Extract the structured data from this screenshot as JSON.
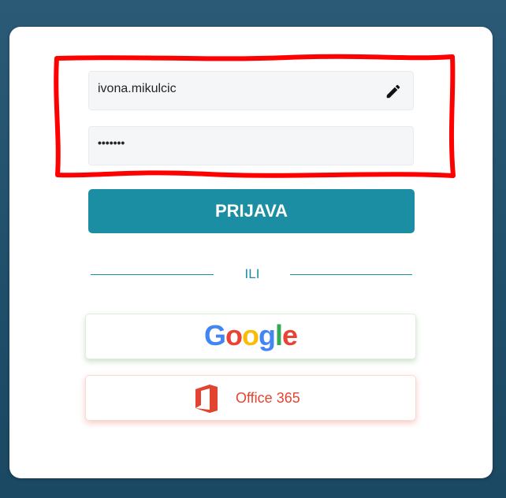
{
  "login": {
    "username_value": "ivona.mikulcic",
    "password_masked": "•••••••",
    "submit_label": "PRIJAVA",
    "divider_text": "ILI"
  },
  "social": {
    "google": {
      "letters": [
        "G",
        "o",
        "o",
        "g",
        "l",
        "e"
      ],
      "colors": [
        "#4285f4",
        "#ea4335",
        "#fbbc05",
        "#4285f4",
        "#34a853",
        "#ea4335"
      ],
      "icon": "google-logo"
    },
    "office": {
      "label": "Office 365",
      "icon": "office-logo-icon",
      "color": "#e2442f"
    }
  },
  "icons": {
    "edit": "pencil-icon"
  },
  "colors": {
    "accent": "#1b8ea3",
    "highlight": "#ff0000",
    "background": "#22506c"
  }
}
